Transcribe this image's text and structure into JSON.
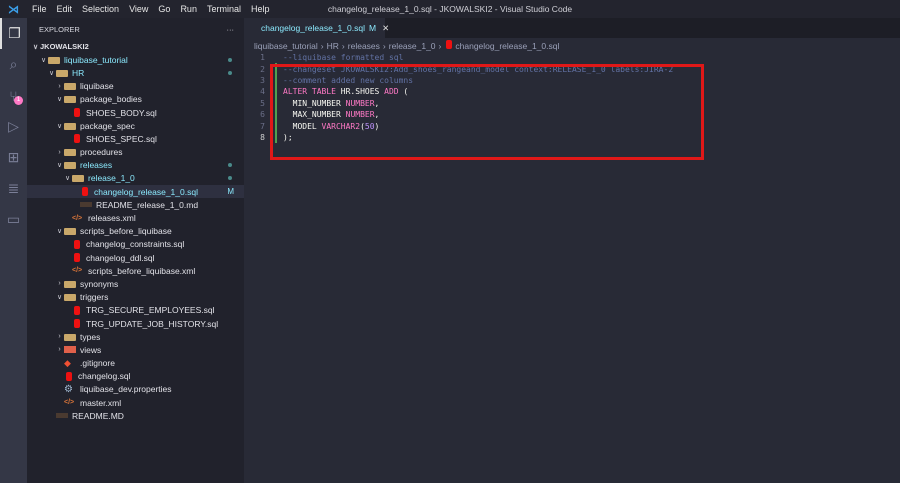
{
  "window": {
    "title": "changelog_release_1_0.sql - JKOWALSKI2 - Visual Studio Code"
  },
  "menu": [
    "File",
    "Edit",
    "Selection",
    "View",
    "Go",
    "Run",
    "Terminal",
    "Help"
  ],
  "activity": [
    {
      "icon": "files-icon"
    },
    {
      "icon": "search-icon"
    },
    {
      "icon": "source-control-icon",
      "badge": "1"
    },
    {
      "icon": "run-debug-icon"
    },
    {
      "icon": "extensions-icon"
    },
    {
      "icon": "database-icon"
    },
    {
      "icon": "folder-icon"
    }
  ],
  "sidebar": {
    "title": "EXPLORER",
    "more": "···",
    "root": "JKOWALSKI2",
    "items": [
      {
        "label": "liquibase_tutorial",
        "type": "folder",
        "level": 1,
        "open": true,
        "dot": true,
        "color": "cyan"
      },
      {
        "label": "HR",
        "type": "folder",
        "level": 2,
        "open": true,
        "dot": true,
        "color": "cyan"
      },
      {
        "label": "liquibase",
        "type": "folder",
        "level": 3,
        "open": false
      },
      {
        "label": "package_bodies",
        "type": "folder",
        "level": 3,
        "open": true
      },
      {
        "label": "SHOES_BODY.sql",
        "type": "sql",
        "level": 4
      },
      {
        "label": "package_spec",
        "type": "folder",
        "level": 3,
        "open": true
      },
      {
        "label": "SHOES_SPEC.sql",
        "type": "sql",
        "level": 4
      },
      {
        "label": "procedures",
        "type": "folder",
        "level": 3,
        "open": false
      },
      {
        "label": "releases",
        "type": "folder",
        "level": 3,
        "open": true,
        "dot": true,
        "color": "cyan"
      },
      {
        "label": "release_1_0",
        "type": "folder",
        "level": 4,
        "open": true,
        "dot": true,
        "color": "cyan"
      },
      {
        "label": "changelog_release_1_0.sql",
        "type": "sql",
        "level": 5,
        "selected": true,
        "status": "M",
        "color": "cyan"
      },
      {
        "label": "README_release_1_0.md",
        "type": "md",
        "level": 5
      },
      {
        "label": "releases.xml",
        "type": "xml",
        "level": 4
      },
      {
        "label": "scripts_before_liquibase",
        "type": "folder",
        "level": 3,
        "open": true
      },
      {
        "label": "changelog_constraints.sql",
        "type": "sql",
        "level": 4
      },
      {
        "label": "changelog_ddl.sql",
        "type": "sql",
        "level": 4
      },
      {
        "label": "scripts_before_liquibase.xml",
        "type": "xml",
        "level": 4
      },
      {
        "label": "synonyms",
        "type": "folder",
        "level": 3,
        "open": false
      },
      {
        "label": "triggers",
        "type": "folder",
        "level": 3,
        "open": true
      },
      {
        "label": "TRG_SECURE_EMPLOYEES.sql",
        "type": "sql",
        "level": 4
      },
      {
        "label": "TRG_UPDATE_JOB_HISTORY.sql",
        "type": "sql",
        "level": 4
      },
      {
        "label": "types",
        "type": "folder",
        "level": 3,
        "open": false
      },
      {
        "label": "views",
        "type": "views",
        "level": 3,
        "open": false
      },
      {
        "label": ".gitignore",
        "type": "git",
        "level": 3
      },
      {
        "label": "changelog.sql",
        "type": "sql",
        "level": 3
      },
      {
        "label": "liquibase_dev.properties",
        "type": "prop",
        "level": 3
      },
      {
        "label": "master.xml",
        "type": "xml",
        "level": 3
      },
      {
        "label": "README.MD",
        "type": "md",
        "level": 2
      }
    ]
  },
  "tab": {
    "label": "changelog_release_1_0.sql",
    "status": "M",
    "close": "✕"
  },
  "breadcrumbs": [
    "liquibase_tutorial",
    "HR",
    "releases",
    "release_1_0",
    "changelog_release_1_0.sql"
  ],
  "code": [
    [
      [
        "cm",
        "--liquibase formatted sql"
      ]
    ],
    [
      [
        "cm",
        "--changeset JKOWALSKI2:Add_shoes_rangeand_model context:RELEASE_1_0 labels:JIRA-2"
      ]
    ],
    [
      [
        "cm",
        "--comment added new columns"
      ]
    ],
    [
      [
        "kw",
        "ALTER TABLE "
      ],
      [
        "tx",
        "HR.SHOES "
      ],
      [
        "kw",
        "ADD"
      ],
      [
        "tx",
        " ("
      ]
    ],
    [
      [
        "tx",
        "  MIN_NUMBER "
      ],
      [
        "kw",
        "NUMBER"
      ],
      [
        "tx",
        ","
      ]
    ],
    [
      [
        "tx",
        "  MAX_NUMBER "
      ],
      [
        "kw",
        "NUMBER"
      ],
      [
        "tx",
        ","
      ]
    ],
    [
      [
        "tx",
        "  MODEL "
      ],
      [
        "kw",
        "VARCHAR2"
      ],
      [
        "tx",
        "("
      ],
      [
        "num",
        "50"
      ],
      [
        "tx",
        ")"
      ]
    ],
    [
      [
        "tx",
        ");"
      ]
    ]
  ],
  "current_line": 8
}
